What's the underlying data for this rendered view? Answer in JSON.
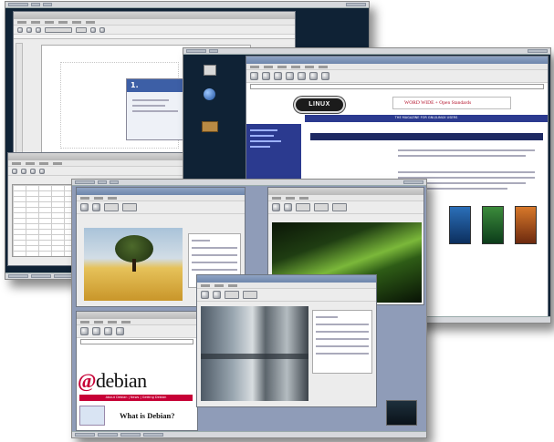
{
  "composite": {
    "back_screen": {
      "panel_chips": 8,
      "doc_heading": "1.",
      "doc_lines": [
        "",
        "",
        ""
      ]
    },
    "mid_screen": {
      "linux_badge": "LINUX",
      "headline": "WORD WIDE + Open Standards",
      "bluebar": "THE MAGAZINE FOR GNU/LINUX USERS",
      "desktop_icons": [
        "computer-icon",
        "globe-icon",
        "trash-icon"
      ]
    },
    "front_screen": {
      "debian_logo": "debian",
      "what_is": "What is Debian?",
      "debian_nav": "About Debian | News | Getting Debian",
      "file_manager_title": "",
      "image_viewer_title": ""
    }
  },
  "colors": {
    "backdrop_dark": "#0f2235",
    "linux_blue": "#2b3a8f",
    "debian_red": "#c70036",
    "title_blue": "#6e86ac"
  }
}
